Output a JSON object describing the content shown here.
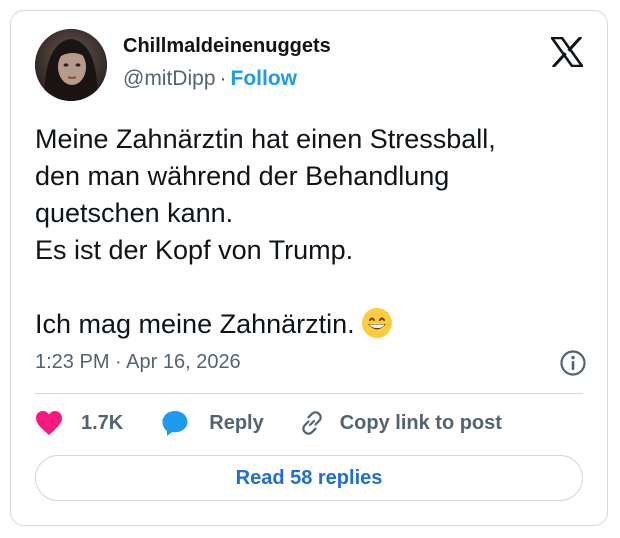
{
  "author": {
    "display_name": "Chillmaldeinenuggets",
    "handle": "@mitDipp",
    "separator": "·",
    "follow_label": "Follow"
  },
  "tweet": {
    "lines": [
      "Meine Zahnärztin hat einen Stressball,",
      "den man während der Behandlung",
      "quetschen kann.",
      "Es ist der Kopf von Trump.",
      "",
      "Ich mag meine Zahnärztin."
    ],
    "emoji": "grinning-face-with-smiling-eyes",
    "timestamp": "1:23 PM · Apr 16, 2026"
  },
  "actions": {
    "like_count": "1.7K",
    "reply_label": "Reply",
    "copy_label": "Copy link to post"
  },
  "read_replies_label": "Read 58 replies",
  "icons": {
    "logo": "x-logo-icon",
    "info": "info-icon",
    "like": "heart-icon",
    "reply": "speech-bubble-icon",
    "copy": "link-icon"
  },
  "colors": {
    "accent": "#1d9bf0",
    "like": "#f91880",
    "muted": "#536471",
    "text": "#0f1419",
    "border": "#cfd9de"
  }
}
